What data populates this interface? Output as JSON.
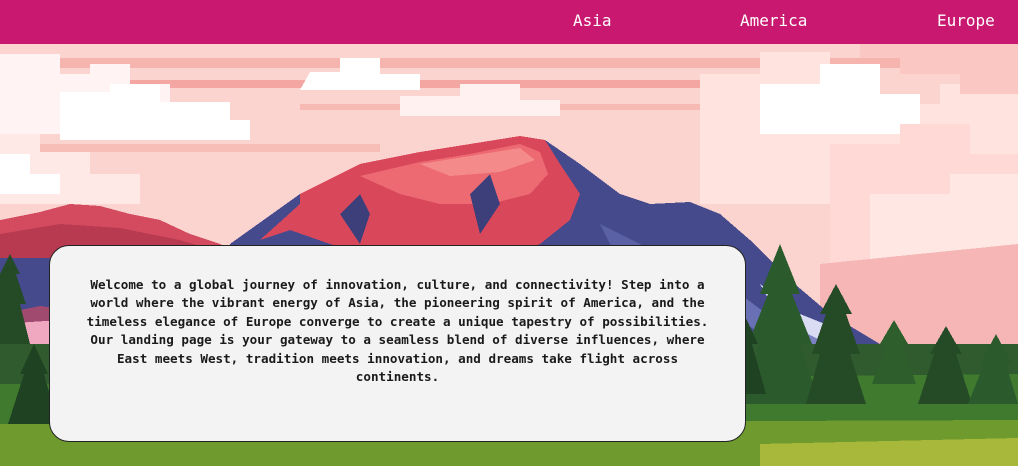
{
  "nav": {
    "items": [
      {
        "label": "Asia"
      },
      {
        "label": "America"
      },
      {
        "label": "Europe"
      }
    ]
  },
  "hero": {
    "background": "pixel-art-mountain-landscape",
    "intro_text": "Welcome to a global journey of innovation, culture, and connectivity! Step into a world where the vibrant energy of Asia, the pioneering spirit of America, and the timeless elegance of Europe converge to create a unique tapestry of possibilities. Our landing page is your gateway to a seamless blend of diverse influences, where East meets West, tradition meets innovation, and dreams take flight across continents."
  },
  "colors": {
    "navbar": "#c81870",
    "nav_text": "#ffffff",
    "card_background": "#f3f3f3",
    "sky": "#fbd3cf",
    "mountain_red": "#d9475a",
    "mountain_blue": "#454a8c",
    "forest_green": "#2f5b2e"
  }
}
